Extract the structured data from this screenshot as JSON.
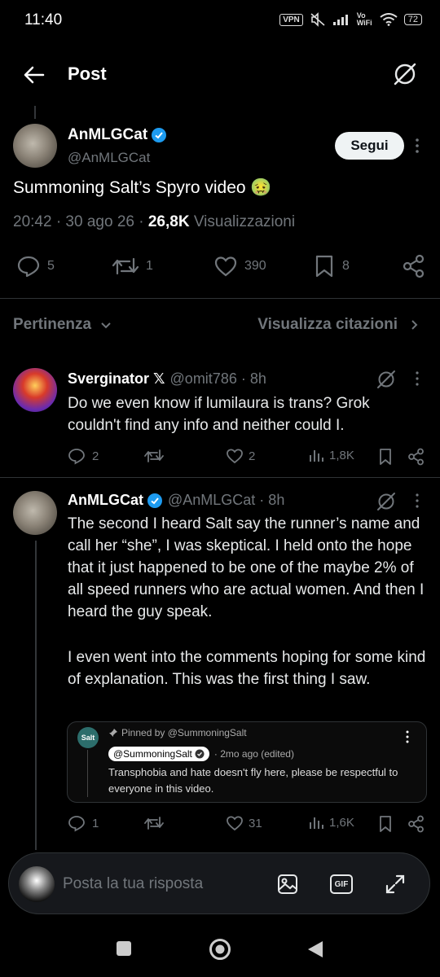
{
  "status_bar": {
    "time": "11:40",
    "vpn": "VPN",
    "volte": "Vo WiFi",
    "battery": "72"
  },
  "header": {
    "title": "Post"
  },
  "post": {
    "author_name": "AnMLGCat",
    "author_handle": "@AnMLGCat",
    "follow_label": "Segui",
    "text": "Summoning Salt’s Spyro video 🤢",
    "time": "20:42 · 30 ago 26 · ",
    "views_count": "26,8K",
    "views_label": " Visualizzazioni",
    "replies": "5",
    "reposts": "1",
    "likes": "390",
    "bookmarks": "8"
  },
  "sort_bar": {
    "sort_label": "Pertinenza",
    "quotes_label": "Visualizza citazioni"
  },
  "replies": [
    {
      "name": "Sverginator 𝕏",
      "handle_time": "@omit786 · 8h",
      "text": "Do we even know if lumilaura is trans? Grok couldn't find any info and neither could I.",
      "replies": "2",
      "reposts": "",
      "likes": "2",
      "views": "1,8K"
    },
    {
      "name": "AnMLGCat",
      "handle_time": "@AnMLGCat · 8h",
      "text1": "The second I heard Salt say the runner’s name and call her “she”, I was skeptical. I held onto the hope that it just happened to be one of the maybe 2% of all speed runners who are actual women. And then I heard the guy speak.",
      "text2": "I even went into the comments hoping for some kind of explanation. This was the first thing I saw.",
      "replies": "1",
      "reposts": "",
      "likes": "31",
      "views": "1,6K"
    }
  ],
  "embed": {
    "logo_text": "Salt",
    "pinned": "Pinned by @SummoningSalt",
    "user": "@SummoningSalt",
    "time": "· 2mo ago (edited)",
    "text": "Transphobia and hate doesn't fly here, please be respectful to everyone in this video."
  },
  "compose": {
    "placeholder": "Posta la tua risposta",
    "gif": "GIF"
  },
  "colors": {
    "background": "#000000",
    "verified": "#1d9bf0",
    "muted": "#71767b",
    "divider": "#2f3336"
  }
}
